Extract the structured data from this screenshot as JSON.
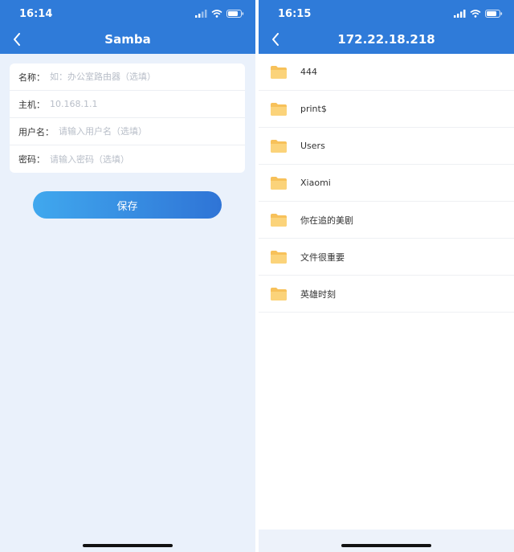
{
  "left_screen": {
    "status_time": "16:14",
    "title": "Samba",
    "form": [
      {
        "label": "名称：",
        "placeholder": "如：办公室路由器（选填）"
      },
      {
        "label": "主机：",
        "placeholder": "10.168.1.1"
      },
      {
        "label": "用户名：",
        "placeholder": "请输入用户名（选填）"
      },
      {
        "label": "密码：",
        "placeholder": "请输入密码（选填）"
      }
    ],
    "save_label": "保存"
  },
  "right_screen": {
    "status_time": "16:15",
    "title": "172.22.18.218",
    "items": [
      {
        "name": "444"
      },
      {
        "name": "print$"
      },
      {
        "name": "Users"
      },
      {
        "name": "Xiaomi"
      },
      {
        "name": "你在追的美剧"
      },
      {
        "name": "文件很重要"
      },
      {
        "name": "英雄时刻"
      }
    ]
  },
  "colors": {
    "header": "#2f7bd9",
    "page_bg": "#eaf1fb",
    "folder": "#f7c15a",
    "button_start": "#40a8ee",
    "button_end": "#2f74d6"
  },
  "icons": [
    "back-chevron-icon",
    "signal-icon",
    "wifi-icon",
    "battery-icon",
    "folder-icon"
  ]
}
